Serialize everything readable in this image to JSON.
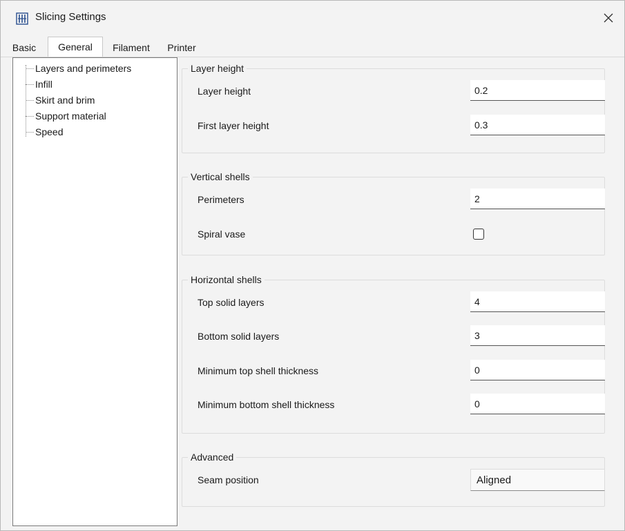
{
  "window": {
    "title": "Slicing Settings",
    "app_icon": "app-logo-icon",
    "close_icon": "close-icon"
  },
  "tabs": [
    {
      "label": "Basic",
      "active": false
    },
    {
      "label": "General",
      "active": true
    },
    {
      "label": "Filament",
      "active": false
    },
    {
      "label": "Printer",
      "active": false
    }
  ],
  "tree": {
    "items": [
      {
        "label": "Layers and perimeters"
      },
      {
        "label": "Infill"
      },
      {
        "label": "Skirt and brim"
      },
      {
        "label": "Support material"
      },
      {
        "label": "Speed"
      }
    ]
  },
  "groups": {
    "layer_height": {
      "title": "Layer height",
      "layer_height_label": "Layer height",
      "layer_height_value": "0.2",
      "first_layer_height_label": "First layer height",
      "first_layer_height_value": "0.3"
    },
    "vertical_shells": {
      "title": "Vertical shells",
      "perimeters_label": "Perimeters",
      "perimeters_value": "2",
      "spiral_vase_label": "Spiral vase",
      "spiral_vase_checked": false
    },
    "horizontal_shells": {
      "title": "Horizontal shells",
      "top_solid_layers_label": "Top solid layers",
      "top_solid_layers_value": "4",
      "bottom_solid_layers_label": "Bottom solid layers",
      "bottom_solid_layers_value": "3",
      "min_top_shell_label": "Minimum top shell thickness",
      "min_top_shell_value": "0",
      "min_bottom_shell_label": "Minimum bottom shell thickness",
      "min_bottom_shell_value": "0"
    },
    "advanced": {
      "title": "Advanced",
      "seam_position_label": "Seam position",
      "seam_position_value": "Aligned"
    }
  }
}
